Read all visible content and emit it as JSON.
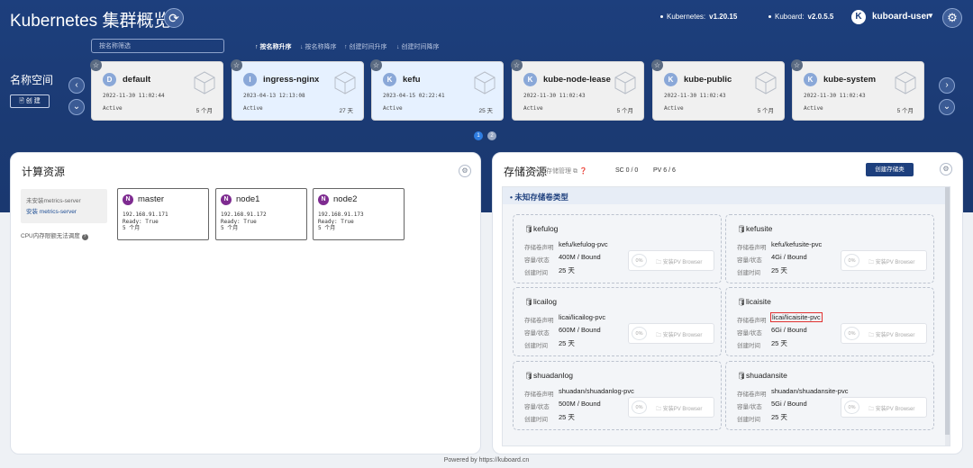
{
  "header": {
    "title": "Kubernetes 集群概览",
    "k8s_label": "Kubernetes:",
    "k8s_version": "v1.20.15",
    "kuboard_label": "Kuboard:",
    "kuboard_version": "v2.0.5.5",
    "user_initial": "K",
    "user_name": "kuboard-user"
  },
  "toolbar": {
    "filter_placeholder": "按名称筛选",
    "sort_options": [
      {
        "label": "↑ 按名称升序",
        "active": true
      },
      {
        "label": "↓ 按名称降序",
        "active": false
      },
      {
        "label": "↑ 创建时间升序",
        "active": false
      },
      {
        "label": "↓ 创建时间降序",
        "active": false
      }
    ]
  },
  "namespaces": {
    "label": "名称空间",
    "create_label": "🖹 创 建",
    "items": [
      {
        "initial": "D",
        "name": "default",
        "created": "2022-11-30 11:02:44",
        "status": "Active",
        "age": "5 个月",
        "selected": false
      },
      {
        "initial": "I",
        "name": "ingress-nginx",
        "created": "2023-04-13 12:13:08",
        "status": "Active",
        "age": "27 天",
        "selected": true
      },
      {
        "initial": "K",
        "name": "kefu",
        "created": "2023-04-15 02:22:41",
        "status": "Active",
        "age": "25 天",
        "selected": true
      },
      {
        "initial": "K",
        "name": "kube-node-lease",
        "created": "2022-11-30 11:02:43",
        "status": "Active",
        "age": "5 个月",
        "selected": false
      },
      {
        "initial": "K",
        "name": "kube-public",
        "created": "2022-11-30 11:02:43",
        "status": "Active",
        "age": "5 个月",
        "selected": false
      },
      {
        "initial": "K",
        "name": "kube-system",
        "created": "2022-11-30 11:02:43",
        "status": "Active",
        "age": "5 个月",
        "selected": false
      }
    ],
    "pages": [
      "1",
      "2"
    ],
    "current_page": "1"
  },
  "compute": {
    "title": "计算资源",
    "metrics_missing": "未安装metrics-server",
    "metrics_install": "安装 metrics-server",
    "cpu_note": "CPU内存限额无法调度",
    "nodes": [
      {
        "initial": "N",
        "name": "master",
        "ip": "192.168.91.171",
        "ready": "Ready: True",
        "age": "5 个月"
      },
      {
        "initial": "N",
        "name": "node1",
        "ip": "192.168.91.172",
        "ready": "Ready: True",
        "age": "5 个月"
      },
      {
        "initial": "N",
        "name": "node2",
        "ip": "192.168.91.173",
        "ready": "Ready: True",
        "age": "5 个月"
      }
    ]
  },
  "storage": {
    "title": "存储资源",
    "subtitle": "K8s存储管理",
    "sc": "SC 0 / 0",
    "pv": "PV 6 / 6",
    "create_class": "创建存储类",
    "group_title": "未知存储卷类型",
    "row_labels": {
      "claim": "存储卷声明",
      "capacity": "容量/状态",
      "created": "创建时间"
    },
    "browser_label": "安装PV Browser",
    "pvcs": [
      {
        "name": "kefulog",
        "claim": "kefu/kefulog-pvc",
        "capacity": "400M / Bound",
        "created": "25 天",
        "pct": "0%",
        "highlight": false
      },
      {
        "name": "kefusite",
        "claim": "kefu/kefusite-pvc",
        "capacity": "4Gi / Bound",
        "created": "25 天",
        "pct": "0%",
        "highlight": false
      },
      {
        "name": "licailog",
        "claim": "licai/licailog-pvc",
        "capacity": "600M / Bound",
        "created": "25 天",
        "pct": "0%",
        "highlight": false
      },
      {
        "name": "licaisite",
        "claim": "licai/licaisite-pvc",
        "capacity": "6Gi / Bound",
        "created": "25 天",
        "pct": "0%",
        "highlight": true
      },
      {
        "name": "shuadanlog",
        "claim": "shuadan/shuadanlog-pvc",
        "capacity": "500M / Bound",
        "created": "25 天",
        "pct": "0%",
        "highlight": false
      },
      {
        "name": "shuadansite",
        "claim": "shuadan/shuadansite-pvc",
        "capacity": "5Gi / Bound",
        "created": "25 天",
        "pct": "0%",
        "highlight": false
      }
    ]
  },
  "footer": {
    "text": "Powered by https://kuboard.cn"
  }
}
